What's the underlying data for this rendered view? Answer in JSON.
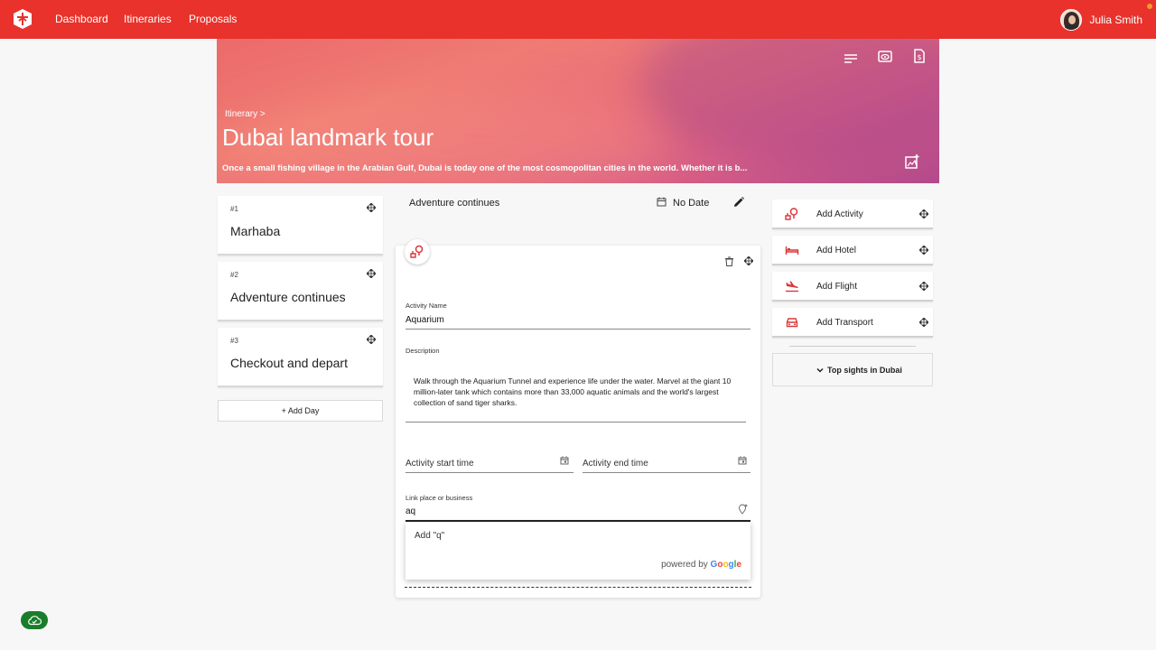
{
  "topbar": {
    "nav": [
      "Dashboard",
      "Itineraries",
      "Proposals"
    ],
    "user_name": "Julia Smith",
    "brand_color": "#e8322b"
  },
  "hero": {
    "breadcrumb": "Itinerary >",
    "title": "Dubai landmark tour",
    "description": "Once a small fishing village in the Arabian Gulf, Dubai is today one of the most cosmopolitan cities in the world. Whether it is b...",
    "icons": [
      "menu-lines-icon",
      "preview-icon",
      "document-dollar-icon",
      "add-image-icon"
    ]
  },
  "days": [
    {
      "num": "#1",
      "name": "Marhaba"
    },
    {
      "num": "#2",
      "name": "Adventure continues"
    },
    {
      "num": "#3",
      "name": "Checkout and depart"
    }
  ],
  "add_day_label": "+ Add Day",
  "day_header": {
    "title": "Adventure continues",
    "date": "No Date"
  },
  "activity": {
    "name_label": "Activity Name",
    "name_value": "Aquarium",
    "description_label": "Description",
    "description_text": "Walk through the Aquarium Tunnel and experience life under the water. Marvel at the giant 10 million-later tank which contains more than 33,000 aquatic animals and the world's largest collection of sand tiger sharks.",
    "start_time_placeholder": "Activity start time",
    "end_time_placeholder": "Activity end time",
    "link_label": "Link place or business",
    "link_value": "aq"
  },
  "autocomplete": {
    "option": "Add \"q\"",
    "powered_by": "powered by",
    "google": [
      "G",
      "o",
      "o",
      "g",
      "l",
      "e"
    ]
  },
  "right_panel": {
    "items": [
      {
        "label": "Add Activity",
        "icon": "activity-icon"
      },
      {
        "label": "Add Hotel",
        "icon": "hotel-bed-icon"
      },
      {
        "label": "Add Flight",
        "icon": "flight-icon"
      },
      {
        "label": "Add Transport",
        "icon": "car-icon"
      }
    ],
    "top_sights": "Top sights in Dubai"
  },
  "accent_color": "#d9383a"
}
